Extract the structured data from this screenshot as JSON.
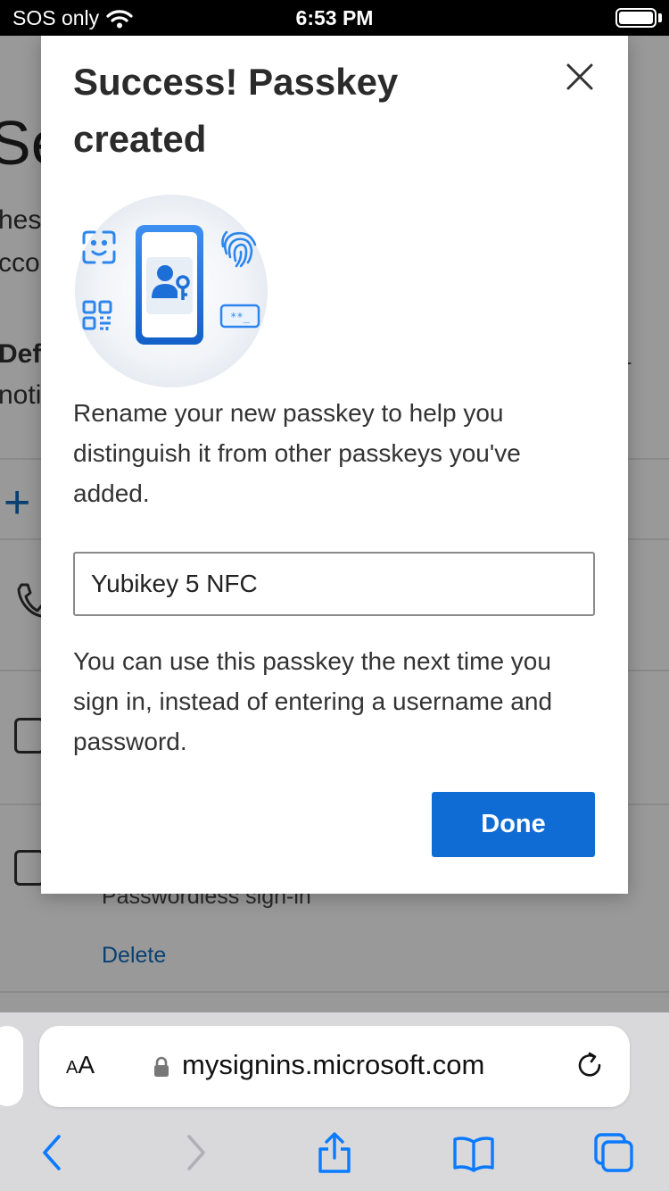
{
  "status_bar": {
    "carrier": "SOS only",
    "time": "6:53 PM"
  },
  "background_page": {
    "title_fragment": "Se",
    "line_fragments": [
      "hes",
      "cco"
    ],
    "bold_fragment": "Defa",
    "line_fragment_4": "notif",
    "method_label": "Passwordless sign-in",
    "delete_link": "Delete"
  },
  "modal": {
    "title": "Success! Passkey created",
    "rename_text": "Rename your new passkey to help you distinguish it from other passkeys you've added.",
    "passkey_name": "Yubikey 5 NFC",
    "info_text": "You can use this passkey the next time you sign in, instead of entering a username and password.",
    "done_label": "Done",
    "illustration_icons": [
      "face-scan-icon",
      "phone-passkey-icon",
      "fingerprint-icon",
      "qr-code-icon",
      "pin-pad-icon"
    ]
  },
  "safari": {
    "aa_label_small": "A",
    "aa_label_large": "A",
    "url": "mysignins.microsoft.com",
    "colors": {
      "tint": "#0a7aff",
      "disabled": "#b0b0b5"
    }
  },
  "colors": {
    "accent": "#0f6cd4",
    "link": "#0f6cbd"
  }
}
